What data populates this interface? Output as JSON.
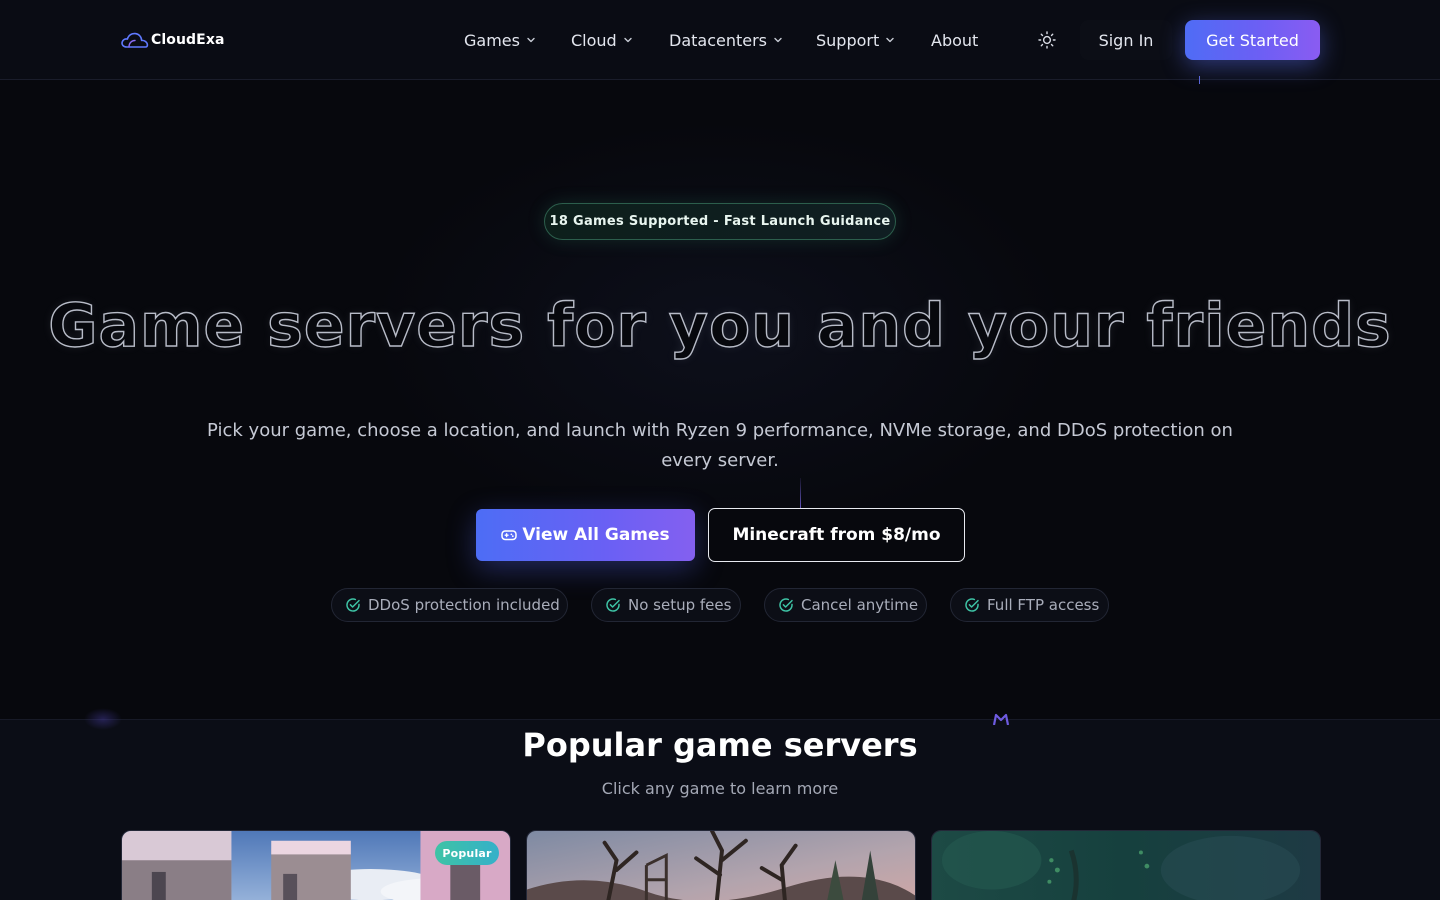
{
  "brand": {
    "name": "CloudExa"
  },
  "nav": {
    "items": [
      {
        "label": "Games",
        "has_dropdown": true
      },
      {
        "label": "Cloud",
        "has_dropdown": true
      },
      {
        "label": "Datacenters",
        "has_dropdown": true
      },
      {
        "label": "Support",
        "has_dropdown": true
      },
      {
        "label": "About",
        "has_dropdown": false
      }
    ],
    "theme_icon": "sun-icon",
    "sign_in_label": "Sign In",
    "get_started_label": "Get Started"
  },
  "hero": {
    "pill_text": "18 Games Supported - Fast Launch Guidance",
    "headline": "Game servers for you and your friends",
    "subtitle": "Pick your game, choose a location, and launch with Ryzen 9 performance, NVMe storage, and DDoS protection on every server.",
    "primary_button": {
      "label": "View All Games",
      "icon": "gamepad-icon"
    },
    "secondary_button": {
      "label": "Minecraft from $8/mo"
    },
    "features": [
      {
        "label": "DDoS protection included",
        "icon": "check-circle-icon"
      },
      {
        "label": "No setup fees",
        "icon": "check-circle-icon"
      },
      {
        "label": "Cancel anytime",
        "icon": "check-circle-icon"
      },
      {
        "label": "Full FTP access",
        "icon": "check-circle-icon"
      }
    ]
  },
  "popular": {
    "title": "Popular game servers",
    "subtitle": "Click any game to learn more",
    "cards": [
      {
        "badge": "Popular"
      },
      {
        "badge": null
      },
      {
        "badge": null
      }
    ]
  },
  "colors": {
    "background": "#07080d",
    "accent_blue": "#4f6cf5",
    "accent_purple": "#8a5cf2",
    "success_green": "#3ec3a5"
  }
}
